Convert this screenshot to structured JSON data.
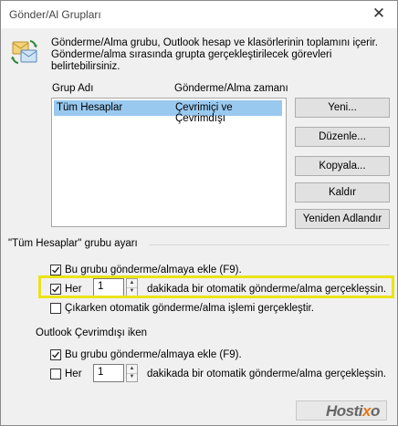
{
  "window": {
    "title": "Gönder/Al Grupları",
    "close_glyph": "✕"
  },
  "header": {
    "icon": "send-receive-icon",
    "description": "Gönderme/Alma grubu, Outlook hesap ve klasörlerinin toplamını içerir. Gönderme/alma sırasında grupta gerçekleştirilecek görevleri belirtebilirsiniz."
  },
  "groups": {
    "col_name": "Grup Adı",
    "col_time": "Gönderme/Alma zamanı",
    "rows": [
      {
        "name": "Tüm Hesaplar",
        "time": "Çevrimiçi ve Çevrimdışı",
        "selected": true
      }
    ]
  },
  "buttons": {
    "new": "Yeni...",
    "edit": "Düzenle...",
    "copy": "Kopyala...",
    "remove": "Kaldır",
    "rename": "Yeniden Adlandır"
  },
  "online_section": {
    "title": "\"Tüm Hesaplar\" grubu ayarı",
    "include_label": "Bu grubu gönderme/almaya ekle (F9).",
    "include_checked": true,
    "every_label": "Her",
    "every_checked": true,
    "every_value": "1",
    "every_suffix": "dakikada bir otomatik gönderme/alma gerçekleşsin.",
    "exit_label": "Çıkarken otomatik gönderme/alma işlemi gerçekleştir.",
    "exit_checked": false
  },
  "offline_section": {
    "title": "Outlook Çevrimdışı iken",
    "include_label": "Bu grubu gönderme/almaya ekle (F9).",
    "include_checked": true,
    "every_label": "Her",
    "every_checked": false,
    "every_value": "1",
    "every_suffix": "dakikada bir otomatik gönderme/alma gerçekleşsin."
  },
  "watermark": {
    "part1": "Hosti",
    "part2": "x",
    "part3": "o"
  },
  "colors": {
    "selection": "#99c9ef",
    "highlight": "#ebe31a",
    "watermark_accent": "#e87711"
  }
}
